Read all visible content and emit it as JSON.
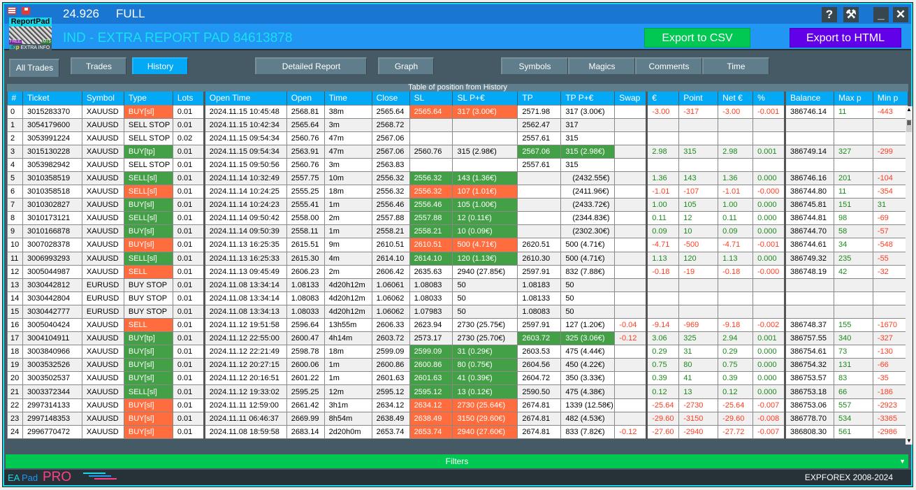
{
  "titlebar": {
    "version": "24.926",
    "edition": "FULL"
  },
  "logo": {
    "name": "ReportPad",
    "badge_free": "FREE",
    "badge_mt5": "MT5",
    "exp_label_1": "Ex",
    "exp_label_2": "p",
    "extra_info": "EXTRA INFO"
  },
  "app_title": "IND - EXTRA REPORT PAD 84613878",
  "window_buttons": {
    "help": "?",
    "tools": "⚒",
    "minimize": "_",
    "close": "✕"
  },
  "export": {
    "csv": "Export to CSV",
    "html": "Export to HTML"
  },
  "nav": {
    "all_trades": "All Trades",
    "trades": "Trades",
    "history": "History",
    "detailed_report": "Detailed Report",
    "graph": "Graph",
    "symbols": "Symbols",
    "magics": "Magics",
    "comments": "Comments",
    "time": "Time",
    "active": "History"
  },
  "table_title": "Table of position from History",
  "columns": [
    "#",
    "Ticket",
    "Symbol",
    "Type",
    "Lots",
    "Open Time",
    "Open",
    "Time",
    "Close",
    "SL",
    "SL P+€",
    "TP",
    "TP P+€",
    "Swap",
    "€",
    "Point",
    "Net €",
    "%",
    "Balance",
    "Max p",
    "Min p"
  ],
  "rows": [
    [
      "0",
      "3015283370",
      "XAUUSD",
      "BUY[sl]",
      "0.01",
      "2024.11.15 10:45:48",
      "2568.81",
      "38m",
      "2565.64",
      "2565.64",
      "317 (3.00€)",
      "2571.98",
      "317 (3.00€)",
      "",
      "-3.00",
      "-317",
      "-3.00",
      "-0.001",
      "386746.14",
      "11",
      "-443"
    ],
    [
      "1",
      "3054179600",
      "XAUUSD",
      "SELL STOP",
      "0.01",
      "2024.11.15 10:42:34",
      "2565.64",
      "3m",
      "2568.72",
      "",
      "",
      "2562.47",
      "317",
      "",
      "",
      "",
      "",
      "",
      "",
      "",
      ""
    ],
    [
      "2",
      "3053991224",
      "XAUUSD",
      "SELL STOP",
      "0.02",
      "2024.11.15 09:54:34",
      "2560.76",
      "47m",
      "2567.06",
      "",
      "",
      "2557.61",
      "315",
      "",
      "",
      "",
      "",
      "",
      "",
      "",
      ""
    ],
    [
      "3",
      "3015130228",
      "XAUUSD",
      "BUY[tp]",
      "0.01",
      "2024.11.15 09:54:34",
      "2563.91",
      "47m",
      "2567.06",
      "2560.76",
      "315 (2.98€)",
      "2567.06",
      "315 (2.98€)",
      "",
      "2.98",
      "315",
      "2.98",
      "0.001",
      "386749.14",
      "327",
      "-299"
    ],
    [
      "4",
      "3053982942",
      "XAUUSD",
      "SELL STOP",
      "0.01",
      "2024.11.15 09:50:56",
      "2560.76",
      "3m",
      "2563.83",
      "",
      "",
      "2557.61",
      "315",
      "",
      "",
      "",
      "",
      "",
      "",
      "",
      ""
    ],
    [
      "5",
      "3010358519",
      "XAUUSD",
      "SELL[sl]",
      "0.01",
      "2024.11.14 10:32:49",
      "2557.75",
      "10m",
      "2556.32",
      "2556.32",
      "143 (1.36€)",
      "",
      "(2432.55€)",
      "",
      "1.36",
      "143",
      "1.36",
      "0.000",
      "386746.16",
      "201",
      "-104"
    ],
    [
      "6",
      "3010358518",
      "XAUUSD",
      "SELL[sl]",
      "0.01",
      "2024.11.14 10:24:25",
      "2555.25",
      "18m",
      "2556.32",
      "2556.32",
      "107 (1.01€)",
      "",
      "(2411.96€)",
      "",
      "-1.01",
      "-107",
      "-1.01",
      "-0.000",
      "386744.80",
      "11",
      "-354"
    ],
    [
      "7",
      "3010302827",
      "XAUUSD",
      "BUY[sl]",
      "0.01",
      "2024.11.14 10:24:23",
      "2555.41",
      "1m",
      "2556.46",
      "2556.46",
      "105 (1.00€)",
      "",
      "(2433.72€)",
      "",
      "1.00",
      "105",
      "1.00",
      "0.000",
      "386745.81",
      "151",
      "31"
    ],
    [
      "8",
      "3010173121",
      "XAUUSD",
      "SELL[sl]",
      "0.01",
      "2024.11.14 09:50:42",
      "2558.00",
      "2m",
      "2557.88",
      "2557.88",
      "12 (0.11€)",
      "",
      "(2344.83€)",
      "",
      "0.11",
      "12",
      "0.11",
      "0.000",
      "386744.81",
      "98",
      "-69"
    ],
    [
      "9",
      "3010166878",
      "XAUUSD",
      "BUY[sl]",
      "0.01",
      "2024.11.14 09:50:39",
      "2558.11",
      "1m",
      "2558.21",
      "2558.21",
      "10 (0.09€)",
      "",
      "(2302.30€)",
      "",
      "0.09",
      "10",
      "0.09",
      "0.000",
      "386744.70",
      "58",
      "-57"
    ],
    [
      "10",
      "3007028378",
      "XAUUSD",
      "BUY[sl]",
      "0.01",
      "2024.11.13 16:25:35",
      "2615.51",
      "9m",
      "2610.51",
      "2610.51",
      "500 (4.71€)",
      "2620.51",
      "500 (4.71€)",
      "",
      "-4.71",
      "-500",
      "-4.71",
      "-0.001",
      "386744.61",
      "34",
      "-548"
    ],
    [
      "11",
      "3006993293",
      "XAUUSD",
      "SELL[sl]",
      "0.01",
      "2024.11.13 16:25:33",
      "2615.30",
      "4m",
      "2614.10",
      "2614.10",
      "120 (1.13€)",
      "2610.30",
      "500 (4.71€)",
      "",
      "1.13",
      "120",
      "1.13",
      "0.000",
      "386749.32",
      "235",
      "-55"
    ],
    [
      "12",
      "3005044987",
      "XAUUSD",
      "SELL",
      "0.01",
      "2024.11.13 09:45:49",
      "2606.23",
      "2m",
      "2606.42",
      "2635.63",
      "2940 (27.85€)",
      "2597.91",
      "832 (7.88€)",
      "",
      "-0.18",
      "-19",
      "-0.18",
      "-0.000",
      "386748.19",
      "42",
      "-32"
    ],
    [
      "13",
      "3030442812",
      "EURUSD",
      "BUY STOP",
      "0.01",
      "2024.11.08 13:34:14",
      "1.08133",
      "4d20h12m",
      "1.06061",
      "1.08083",
      "50",
      "1.08183",
      "50",
      "",
      "",
      "",
      "",
      "",
      "",
      "",
      ""
    ],
    [
      "14",
      "3030442804",
      "EURUSD",
      "BUY STOP",
      "0.01",
      "2024.11.08 13:34:14",
      "1.08083",
      "4d20h12m",
      "1.06062",
      "1.08033",
      "50",
      "1.08133",
      "50",
      "",
      "",
      "",
      "",
      "",
      "",
      "",
      ""
    ],
    [
      "15",
      "3030442777",
      "EURUSD",
      "BUY STOP",
      "0.01",
      "2024.11.08 13:34:13",
      "1.08033",
      "4d20h12m",
      "1.06062",
      "1.07983",
      "50",
      "1.08083",
      "50",
      "",
      "",
      "",
      "",
      "",
      "",
      "",
      ""
    ],
    [
      "16",
      "3005040424",
      "XAUUSD",
      "SELL",
      "0.01",
      "2024.11.12 19:51:58",
      "2596.64",
      "13h55m",
      "2606.33",
      "2623.94",
      "2730 (25.75€)",
      "2597.91",
      "127 (1.20€)",
      "-0.04",
      "-9.14",
      "-969",
      "-9.18",
      "-0.002",
      "386748.37",
      "155",
      "-1670"
    ],
    [
      "17",
      "3004104911",
      "XAUUSD",
      "BUY[tp]",
      "0.01",
      "2024.11.12 22:55:00",
      "2600.47",
      "4h14m",
      "2603.72",
      "2573.17",
      "2730 (25.70€)",
      "2603.72",
      "325 (3.06€)",
      "-0.12",
      "3.06",
      "325",
      "2.94",
      "0.001",
      "386757.55",
      "340",
      "-327"
    ],
    [
      "18",
      "3003840966",
      "XAUUSD",
      "BUY[sl]",
      "0.01",
      "2024.11.12 22:21:49",
      "2598.78",
      "18m",
      "2599.09",
      "2599.09",
      "31 (0.29€)",
      "2603.53",
      "475 (4.44€)",
      "",
      "0.29",
      "31",
      "0.29",
      "0.000",
      "386754.61",
      "73",
      "-130"
    ],
    [
      "19",
      "3003532526",
      "XAUUSD",
      "BUY[sl]",
      "0.01",
      "2024.11.12 20:27:15",
      "2600.06",
      "1m",
      "2600.86",
      "2600.86",
      "80 (0.75€)",
      "2604.56",
      "450 (4.22€)",
      "",
      "0.75",
      "80",
      "0.75",
      "0.000",
      "386754.32",
      "131",
      "-66"
    ],
    [
      "20",
      "3003502537",
      "XAUUSD",
      "BUY[sl]",
      "0.01",
      "2024.11.12 20:16:51",
      "2601.22",
      "1m",
      "2601.63",
      "2601.63",
      "41 (0.39€)",
      "2604.72",
      "350 (3.33€)",
      "",
      "0.39",
      "41",
      "0.39",
      "0.000",
      "386753.57",
      "83",
      "-35"
    ],
    [
      "21",
      "3003372344",
      "XAUUSD",
      "SELL[sl]",
      "0.01",
      "2024.11.12 19:33:02",
      "2595.25",
      "12m",
      "2595.12",
      "2595.12",
      "13 (0.12€)",
      "2590.50",
      "475 (4.38€)",
      "",
      "0.12",
      "13",
      "0.12",
      "0.000",
      "386753.18",
      "66",
      "-186"
    ],
    [
      "22",
      "2997314133",
      "XAUUSD",
      "BUY[sl]",
      "0.01",
      "2024.11.11 12:59:00",
      "2661.42",
      "3h1m",
      "2634.12",
      "2634.12",
      "2730 (25.64€)",
      "2674.81",
      "1339 (12.58€)",
      "",
      "-25.64",
      "-2730",
      "-25.64",
      "-0.007",
      "386753.06",
      "557",
      "-2923"
    ],
    [
      "23",
      "2997148353",
      "XAUUSD",
      "BUY[sl]",
      "0.01",
      "2024.11.11 06:46:37",
      "2669.99",
      "8h54m",
      "2638.49",
      "2638.49",
      "3150 (29.60€)",
      "2674.81",
      "482 (4.53€)",
      "",
      "-29.60",
      "-3150",
      "-29.60",
      "-0.008",
      "386778.70",
      "534",
      "-3365"
    ],
    [
      "24",
      "2996770472",
      "XAUUSD",
      "BUY[sl]",
      "0.01",
      "2024.11.08 18:59:58",
      "2683.14",
      "2d20h0m",
      "2653.74",
      "2653.74",
      "2940 (27.60€)",
      "2674.81",
      "833 (7.82€)",
      "-0.12",
      "-27.60",
      "-2940",
      "-27.72",
      "-0.007",
      "386808.30",
      "561",
      "-2986"
    ]
  ],
  "row_highlights": {
    "type": [
      "r",
      "",
      "",
      "g",
      "",
      "g",
      "r",
      "g",
      "g",
      "g",
      "r",
      "g",
      "r",
      "",
      "",
      "",
      "r",
      "g",
      "g",
      "g",
      "g",
      "g",
      "r",
      "r",
      "r"
    ],
    "sl": [
      "r",
      "",
      "",
      "",
      "",
      "g",
      "r",
      "g",
      "g",
      "g",
      "r",
      "g",
      "",
      "",
      "",
      "",
      "",
      "",
      "g",
      "g",
      "g",
      "g",
      "r",
      "r",
      "r"
    ],
    "tp": [
      "",
      "",
      "",
      "g",
      "",
      "",
      "",
      "",
      "",
      "",
      "",
      "",
      "",
      "",
      "",
      "",
      "",
      "g",
      "",
      "",
      "",
      "",
      "",
      "",
      ""
    ]
  },
  "colors": {
    "positive": "#1b8a1b",
    "negative": "#ff3b1f",
    "win_fill": "#43a047",
    "loss_fill": "#ff6d3f",
    "header": "#03a9f4",
    "accent": "#1ad6e8"
  },
  "filters_label": "Filters",
  "footer": {
    "ea": "EA",
    "pad": "Pad",
    "pro": "PRO",
    "copyright": "EXPFOREX 2008-2024"
  }
}
